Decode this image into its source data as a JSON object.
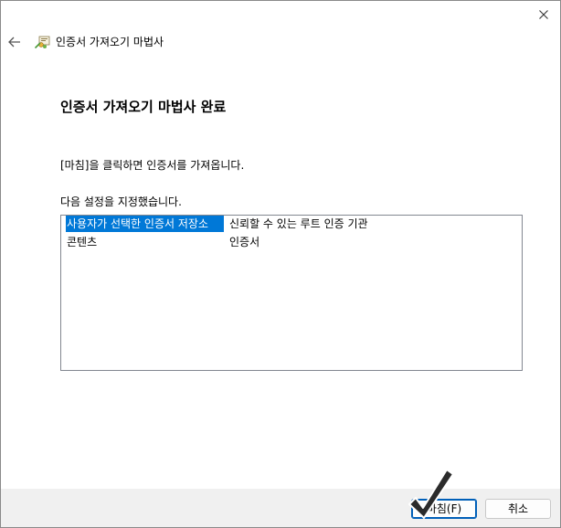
{
  "titlebar": {
    "close_icon": "close-icon"
  },
  "header": {
    "back_icon": "arrow-left-icon",
    "wizard_icon": "certificate-wizard-icon",
    "title": "인증서 가져오기 마법사"
  },
  "main": {
    "heading": "인증서 가져오기 마법사 완료",
    "instruction": "[마침]을 클릭하면 인증서를 가져옵니다.",
    "settings_label": "다음 설정을 지정했습니다.",
    "settings": [
      {
        "key": "사용자가 선택한 인증서 저장소",
        "value": "신뢰할 수 있는 루트 인증 기관",
        "selected": true
      },
      {
        "key": "콘텐츠",
        "value": "인증서",
        "selected": false
      }
    ]
  },
  "footer": {
    "finish_label": "마침(F)",
    "cancel_label": "취소"
  },
  "colors": {
    "selection": "#0078d7",
    "footer_bg": "#f0f0f0",
    "default_button_border": "#005fb8"
  },
  "overlay": {
    "checkmark_icon": "checkmark-icon"
  }
}
